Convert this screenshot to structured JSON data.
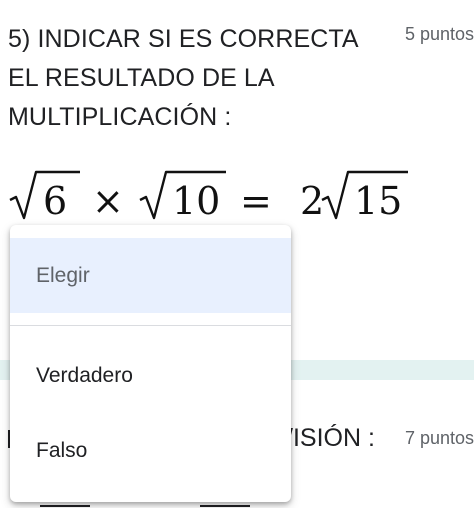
{
  "question5": {
    "title": "5) INDICAR SI ES CORRECTA EL RESULTADO DE LA MULTIPLICACIÓN :",
    "points": "5 puntos",
    "expression": {
      "left_radicand": "6",
      "times": "×",
      "right_radicand": "10",
      "equals": "=",
      "coefficient": "2",
      "result_radicand": "15"
    }
  },
  "dropdown": {
    "options": [
      {
        "label": "Elegir",
        "selected": true
      },
      {
        "label": "Verdadero",
        "selected": false
      },
      {
        "label": "Falso",
        "selected": false
      }
    ]
  },
  "question6": {
    "title_visible": "/ISIÓN :",
    "points": "7 puntos"
  },
  "colors": {
    "text": "#202124",
    "secondary_text": "#5f6368",
    "selected_bg": "#e8f0fe",
    "divider_strip": "#e3f2f1"
  }
}
